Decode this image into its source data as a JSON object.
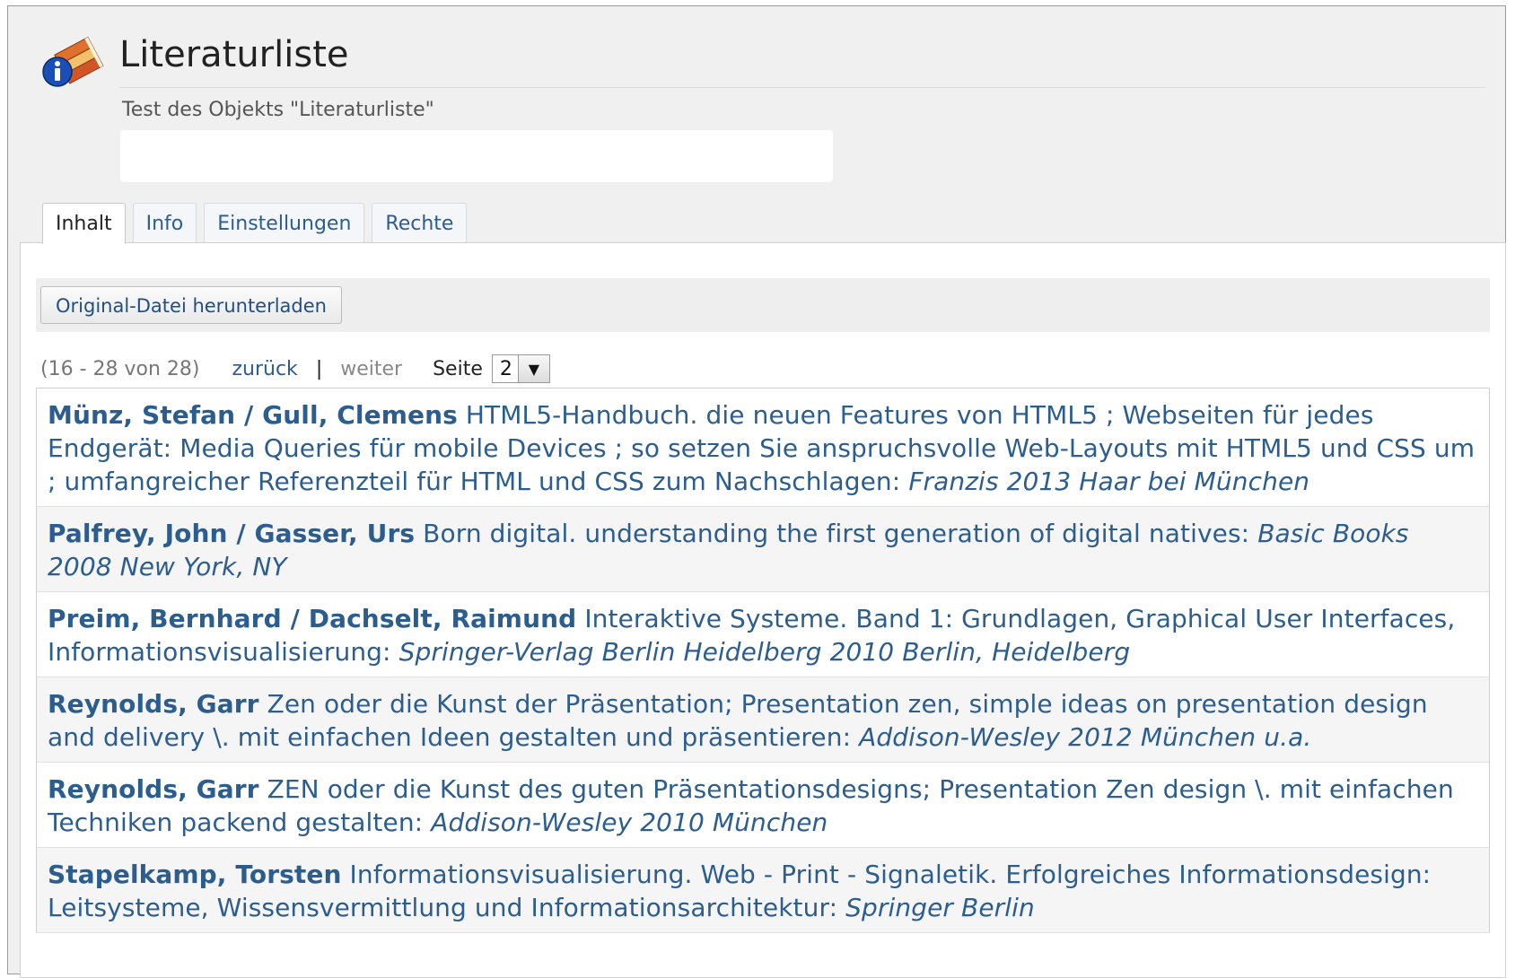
{
  "page": {
    "title": "Literaturliste",
    "description": "Test des Objekts \"Literaturliste\""
  },
  "tabs": [
    {
      "label": "Inhalt",
      "active": true
    },
    {
      "label": "Info",
      "active": false
    },
    {
      "label": "Einstellungen",
      "active": false
    },
    {
      "label": "Rechte",
      "active": false
    }
  ],
  "toolbar": {
    "download_label": "Original-Datei herunterladen"
  },
  "pagination": {
    "count": "(16 - 28 von 28)",
    "back": "zurück",
    "separator": "|",
    "next": "weiter",
    "page_label": "Seite",
    "page_value": "2"
  },
  "entries": [
    {
      "author": "Münz, Stefan / Gull, Clemens",
      "title": "HTML5-Handbuch. die neuen Features von HTML5 ; Webseiten für jedes Endgerät: Media Queries für mobile Devices ; so setzen Sie anspruchsvolle Web-Layouts mit HTML5 und CSS um ; umfangreicher Referenzteil für HTML und CSS zum Nachschlagen:",
      "publisher": "Franzis 2013 Haar bei München"
    },
    {
      "author": "Palfrey, John / Gasser, Urs",
      "title": "Born digital. understanding the first generation of digital natives:",
      "publisher": "Basic Books 2008 New York, NY"
    },
    {
      "author": "Preim, Bernhard / Dachselt, Raimund",
      "title": "Interaktive Systeme. Band 1: Grundlagen, Graphical User Interfaces, Informationsvisualisierung:",
      "publisher": "Springer-Verlag Berlin Heidelberg 2010 Berlin, Heidelberg"
    },
    {
      "author": "Reynolds, Garr",
      "title": "Zen oder die Kunst der Präsentation; Presentation zen, simple ideas on presentation design and delivery \\. mit einfachen Ideen gestalten und präsentieren:",
      "publisher": "Addison-Wesley 2012 München u.a."
    },
    {
      "author": "Reynolds, Garr",
      "title": "ZEN oder die Kunst des guten Präsentationsdesigns; Presentation Zen design \\. mit einfachen Techniken packend gestalten:",
      "publisher": "Addison-Wesley 2010 München"
    },
    {
      "author": "Stapelkamp, Torsten",
      "title": "Informationsvisualisierung. Web - Print - Signaletik. Erfolgreiches Informationsdesign: Leitsysteme, Wissensvermittlung und Informationsarchitektur:",
      "publisher": "Springer Berlin"
    }
  ],
  "icons": {
    "header": "books-info-icon",
    "dropdown": "triangle-down-icon"
  }
}
